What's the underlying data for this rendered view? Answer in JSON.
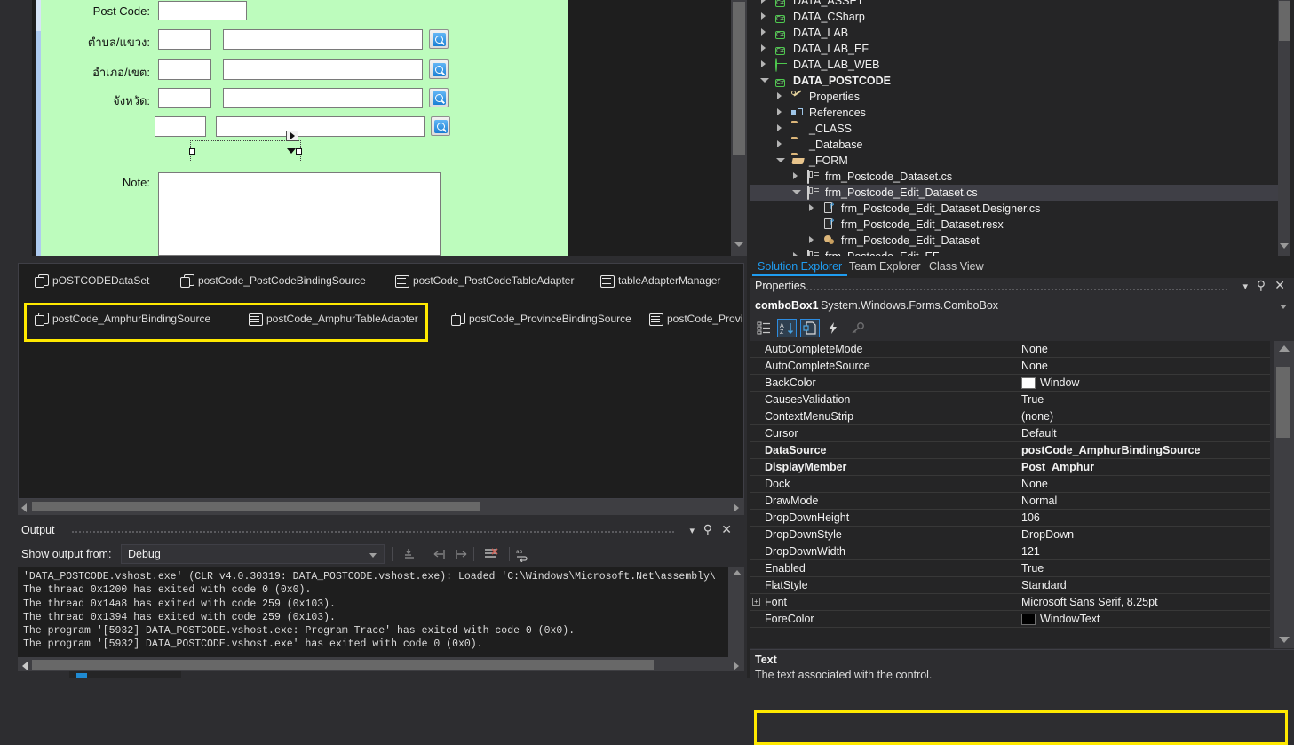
{
  "designer": {
    "fields": [
      {
        "label": "Post Code:"
      },
      {
        "label": "ตำบล/แขวง:"
      },
      {
        "label": "อำเภอ/เขต:"
      },
      {
        "label": "จังหวัด:"
      },
      {
        "label": ""
      },
      {
        "label": "Note:"
      }
    ],
    "search_icon": "magnifier-icon",
    "selected_control": "combobox-selection"
  },
  "tray": {
    "items": [
      {
        "label": "pOSTCODEDataSet",
        "icon": "binding-source-icon"
      },
      {
        "label": "postCode_PostCodeBindingSource",
        "icon": "binding-source-icon"
      },
      {
        "label": "postCode_PostCodeTableAdapter",
        "icon": "table-adapter-icon"
      },
      {
        "label": "tableAdapterManager",
        "icon": "table-adapter-icon"
      },
      {
        "label": "postCode_AmphurBindingSource",
        "icon": "binding-source-icon"
      },
      {
        "label": "postCode_AmphurTableAdapter",
        "icon": "table-adapter-icon"
      },
      {
        "label": "postCode_ProvinceBindingSource",
        "icon": "binding-source-icon"
      },
      {
        "label": "postCode_Provi",
        "icon": "table-adapter-icon"
      }
    ],
    "highlight_color": "#ffe900"
  },
  "output": {
    "title": "Output",
    "show_output_from_label": "Show output from:",
    "source": "Debug",
    "lines": [
      "'DATA_POSTCODE.vshost.exe' (CLR v4.0.30319: DATA_POSTCODE.vshost.exe): Loaded 'C:\\Windows\\Microsoft.Net\\assembly\\",
      "The thread 0x1200 has exited with code 0 (0x0).",
      "The thread 0x14a8 has exited with code 259 (0x103).",
      "The thread 0x1394 has exited with code 259 (0x103).",
      "The program '[5932] DATA_POSTCODE.vshost.exe: Program Trace' has exited with code 0 (0x0).",
      "The program '[5932] DATA_POSTCODE.vshost.exe' has exited with code 0 (0x0)."
    ],
    "toolbar_icons": [
      "find-message-icon",
      "go-to-previous-icon",
      "go-to-next-icon",
      "clear-all-icon",
      "word-wrap-icon"
    ],
    "window_buttons": [
      "chevron-down-icon",
      "pin-icon",
      "close-icon"
    ]
  },
  "solution_explorer": {
    "tabs": [
      {
        "label": "Solution Explorer",
        "active": true
      },
      {
        "label": "Team Explorer",
        "active": false
      },
      {
        "label": "Class View",
        "active": false
      }
    ],
    "nodes": [
      {
        "label": "DATA_ASSET",
        "indent": 0,
        "icon": "csharp-project-icon",
        "state": "closed",
        "bold": false,
        "selected": false
      },
      {
        "label": "DATA_CSharp",
        "indent": 0,
        "icon": "csharp-project-icon",
        "state": "closed",
        "bold": false,
        "selected": false
      },
      {
        "label": "DATA_LAB",
        "indent": 0,
        "icon": "csharp-project-icon",
        "state": "closed",
        "bold": false,
        "selected": false
      },
      {
        "label": "DATA_LAB_EF",
        "indent": 0,
        "icon": "csharp-project-icon",
        "state": "closed",
        "bold": false,
        "selected": false
      },
      {
        "label": "DATA_LAB_WEB",
        "indent": 0,
        "icon": "web-project-icon",
        "state": "closed",
        "bold": false,
        "selected": false
      },
      {
        "label": "DATA_POSTCODE",
        "indent": 0,
        "icon": "csharp-project-icon",
        "state": "open",
        "bold": true,
        "selected": false
      },
      {
        "label": "Properties",
        "indent": 1,
        "icon": "wrench-icon",
        "state": "closed",
        "bold": false,
        "selected": false
      },
      {
        "label": "References",
        "indent": 1,
        "icon": "references-icon",
        "state": "closed",
        "bold": false,
        "selected": false
      },
      {
        "label": "_CLASS",
        "indent": 1,
        "icon": "folder-icon",
        "state": "closed",
        "bold": false,
        "selected": false
      },
      {
        "label": "_Database",
        "indent": 1,
        "icon": "folder-icon",
        "state": "closed",
        "bold": false,
        "selected": false
      },
      {
        "label": "_FORM",
        "indent": 1,
        "icon": "folder-open-icon",
        "state": "open",
        "bold": false,
        "selected": false
      },
      {
        "label": "frm_Postcode_Dataset.cs",
        "indent": 2,
        "icon": "windows-form-icon",
        "state": "closed",
        "bold": false,
        "selected": false
      },
      {
        "label": "frm_Postcode_Edit_Dataset.cs",
        "indent": 2,
        "icon": "windows-form-icon",
        "state": "open",
        "bold": false,
        "selected": true
      },
      {
        "label": "frm_Postcode_Edit_Dataset.Designer.cs",
        "indent": 3,
        "icon": "csharp-file-icon",
        "state": "closed",
        "bold": false,
        "selected": false
      },
      {
        "label": "frm_Postcode_Edit_Dataset.resx",
        "indent": 3,
        "icon": "csharp-file-icon",
        "state": "none",
        "bold": false,
        "selected": false
      },
      {
        "label": "frm_Postcode_Edit_Dataset",
        "indent": 3,
        "icon": "designer-gear-icon",
        "state": "closed",
        "bold": false,
        "selected": false
      },
      {
        "label": "frm_Postcode_Edit_EF",
        "indent": 2,
        "icon": "windows-form-icon",
        "state": "closed",
        "bold": false,
        "selected": false
      }
    ]
  },
  "properties": {
    "title": "Properties",
    "object_name": "comboBox1",
    "object_type": "System.Windows.Forms.ComboBox",
    "toolbar": [
      {
        "name": "categorized-icon",
        "active": false
      },
      {
        "name": "alphabetical-icon",
        "active": true
      },
      {
        "name": "property-pages-icon",
        "active": true
      },
      {
        "name": "events-icon",
        "active": false
      },
      {
        "name": "key-icon",
        "active": false
      }
    ],
    "rows": [
      {
        "name": "AutoCompleteMode",
        "value": "None",
        "bold": false,
        "expand": false,
        "swatch": null
      },
      {
        "name": "AutoCompleteSource",
        "value": "None",
        "bold": false,
        "expand": false,
        "swatch": null
      },
      {
        "name": "BackColor",
        "value": "Window",
        "bold": false,
        "expand": false,
        "swatch": "#ffffff"
      },
      {
        "name": "CausesValidation",
        "value": "True",
        "bold": false,
        "expand": false,
        "swatch": null
      },
      {
        "name": "ContextMenuStrip",
        "value": "(none)",
        "bold": false,
        "expand": false,
        "swatch": null
      },
      {
        "name": "Cursor",
        "value": "Default",
        "bold": false,
        "expand": false,
        "swatch": null
      },
      {
        "name": "DataSource",
        "value": "postCode_AmphurBindingSource",
        "bold": true,
        "expand": false,
        "swatch": null
      },
      {
        "name": "DisplayMember",
        "value": "Post_Amphur",
        "bold": true,
        "expand": false,
        "swatch": null
      },
      {
        "name": "Dock",
        "value": "None",
        "bold": false,
        "expand": false,
        "swatch": null
      },
      {
        "name": "DrawMode",
        "value": "Normal",
        "bold": false,
        "expand": false,
        "swatch": null
      },
      {
        "name": "DropDownHeight",
        "value": "106",
        "bold": false,
        "expand": false,
        "swatch": null
      },
      {
        "name": "DropDownStyle",
        "value": "DropDown",
        "bold": false,
        "expand": false,
        "swatch": null
      },
      {
        "name": "DropDownWidth",
        "value": "121",
        "bold": false,
        "expand": false,
        "swatch": null
      },
      {
        "name": "Enabled",
        "value": "True",
        "bold": false,
        "expand": false,
        "swatch": null
      },
      {
        "name": "FlatStyle",
        "value": "Standard",
        "bold": false,
        "expand": false,
        "swatch": null
      },
      {
        "name": "Font",
        "value": "Microsoft Sans Serif, 8.25pt",
        "bold": false,
        "expand": true,
        "swatch": null
      },
      {
        "name": "ForeColor",
        "value": "WindowText",
        "bold": false,
        "expand": false,
        "swatch": "#000000"
      }
    ],
    "highlighted_row": "DataSource",
    "highlight_color": "#ffe900",
    "description": {
      "title": "Text",
      "body": "The text associated with the control."
    },
    "window_buttons": [
      "chevron-down-icon",
      "pin-icon",
      "close-icon"
    ]
  }
}
